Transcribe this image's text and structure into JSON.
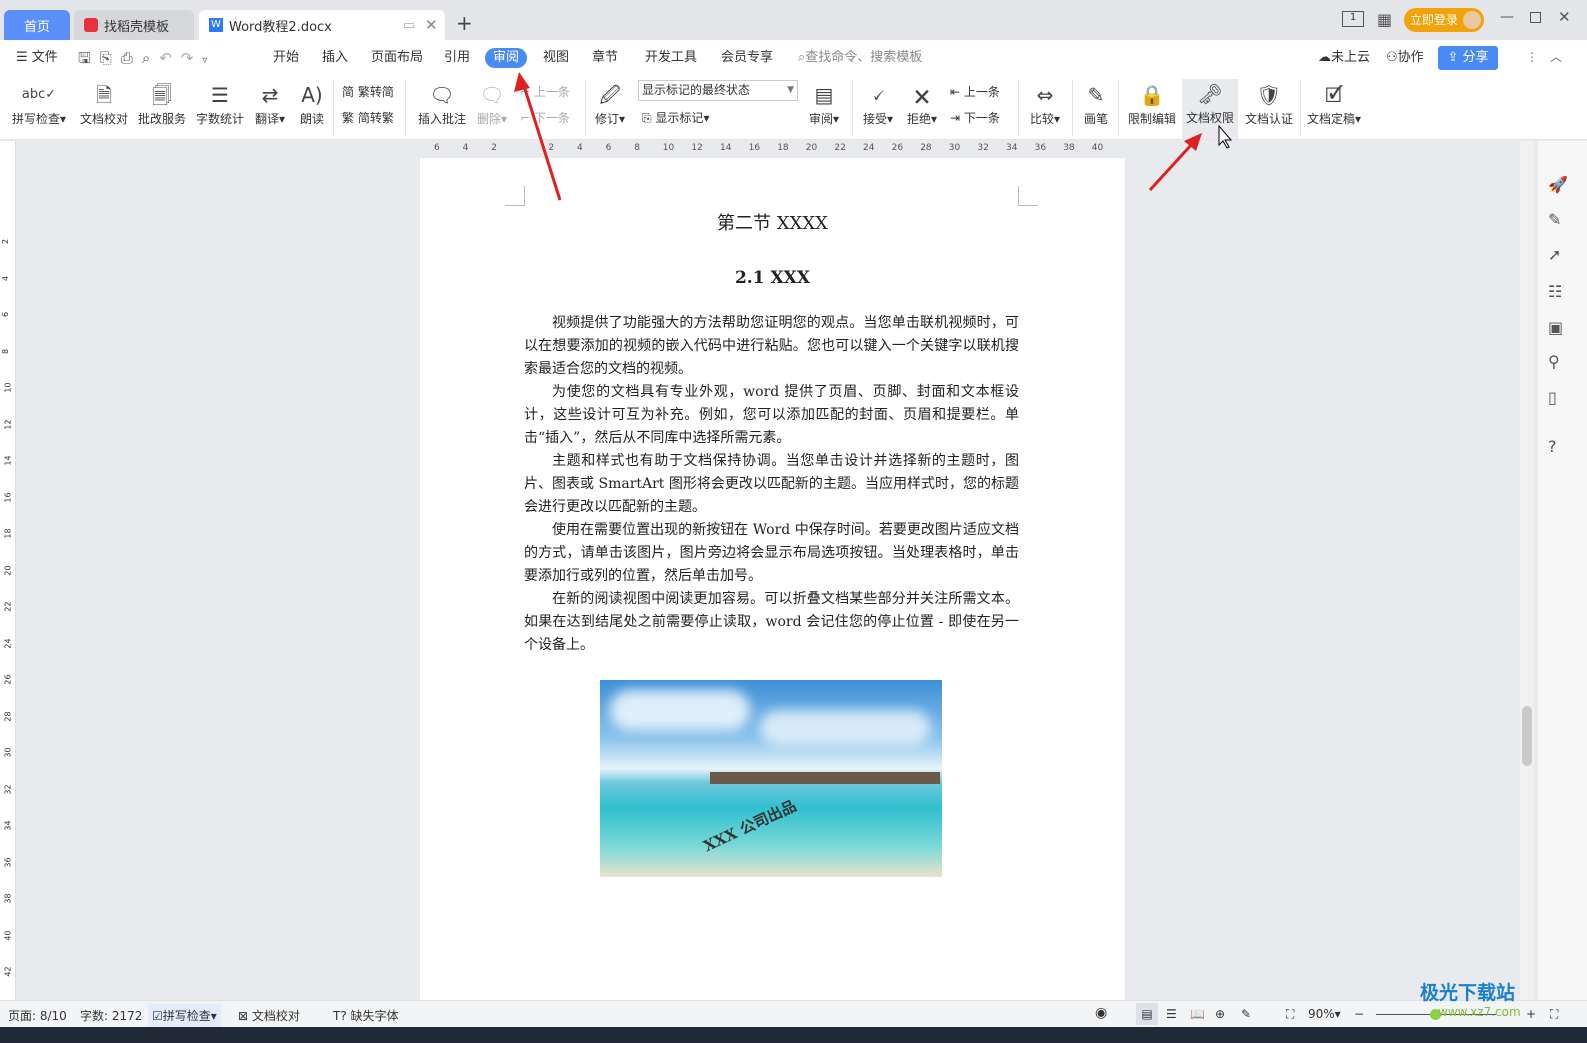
{
  "tabs": [
    {
      "label": "首页",
      "active": false
    },
    {
      "label": "找稻壳模板"
    },
    {
      "label": "Word教程2.docx",
      "active": true
    }
  ],
  "window": {
    "login_label": "立即登录",
    "new_tab": "+"
  },
  "menu": {
    "file": "文件",
    "items": [
      "开始",
      "插入",
      "页面布局",
      "引用",
      "审阅",
      "视图",
      "章节",
      "开发工具",
      "会员专享"
    ],
    "active": "审阅",
    "search_placeholder": "查找命令、搜索模板",
    "cloud": "未上云",
    "collab": "协作",
    "share": "分享"
  },
  "ribbon": {
    "spell": "拼写检查",
    "proof": "文档校对",
    "correct": "批改服务",
    "wordcount": "字数统计",
    "translate": "翻译",
    "read": "朗读",
    "t2s": "繁转简",
    "s2t": "简转繁",
    "insert_comment": "插入批注",
    "delete": "删除",
    "prev_comment": "上一条",
    "next_comment": "下一条",
    "revise": "修订",
    "markup_state": "显示标记的最终状态",
    "show_markup": "显示标记",
    "review": "审阅",
    "accept": "接受",
    "reject": "拒绝",
    "prev_change": "上一条",
    "next_change": "下一条",
    "compare": "比较",
    "pen": "画笔",
    "restrict": "限制编辑",
    "permission": "文档权限",
    "certify": "文档认证",
    "finalize": "文档定稿"
  },
  "ruler_ticks": [
    "6",
    "4",
    "2",
    "",
    "2",
    "4",
    "6",
    "8",
    "10",
    "12",
    "14",
    "16",
    "18",
    "20",
    "22",
    "24",
    "26",
    "28",
    "30",
    "32",
    "34",
    "36",
    "38",
    "40"
  ],
  "vruler_ticks": [
    "2",
    "4",
    "6",
    "8",
    "10",
    "12",
    "14",
    "16",
    "18",
    "20",
    "22",
    "24",
    "26",
    "28",
    "30",
    "32",
    "34",
    "36",
    "38",
    "40",
    "42"
  ],
  "document": {
    "section_title": "第二节  XXXX",
    "heading": "2.1 XXX",
    "paragraphs": [
      "视频提供了功能强大的方法帮助您证明您的观点。当您单击联机视频时，可以在想要添加的视频的嵌入代码中进行粘贴。您也可以键入一个关键字以联机搜索最适合您的文档的视频。",
      "为使您的文档具有专业外观，word 提供了页眉、页脚、封面和文本框设计，这些设计可互为补充。例如，您可以添加匹配的封面、页眉和提要栏。单击“插入”，然后从不同库中选择所需元素。",
      "主题和样式也有助于文档保持协调。当您单击设计并选择新的主题时，图片、图表或 SmartArt 图形将会更改以匹配新的主题。当应用样式时，您的标题会进行更改以匹配新的主题。",
      "使用在需要位置出现的新按钮在 Word 中保存时间。若要更改图片适应文档的方式，请单击该图片，图片旁边将会显示布局选项按钮。当处理表格时，单击要添加行或列的位置，然后单击加号。",
      "在新的阅读视图中阅读更加容易。可以折叠文档某些部分并关注所需文本。如果在达到结尾处之前需要停止读取，word 会记住您的停止位置 - 即使在另一个设备上。"
    ],
    "image_watermark": "XXX 公司出品"
  },
  "status": {
    "page": "页面: 8/10",
    "words": "字数: 2172",
    "spell": "拼写检查",
    "proof": "文档校对",
    "missing_font": "缺失字体",
    "zoom": "90%"
  },
  "site_watermark": {
    "name": "极光下载站",
    "url": "www.xz7.com"
  },
  "colors": {
    "accent": "#4a8af4",
    "login": "#f0a30a",
    "arrow": "#e02020"
  }
}
